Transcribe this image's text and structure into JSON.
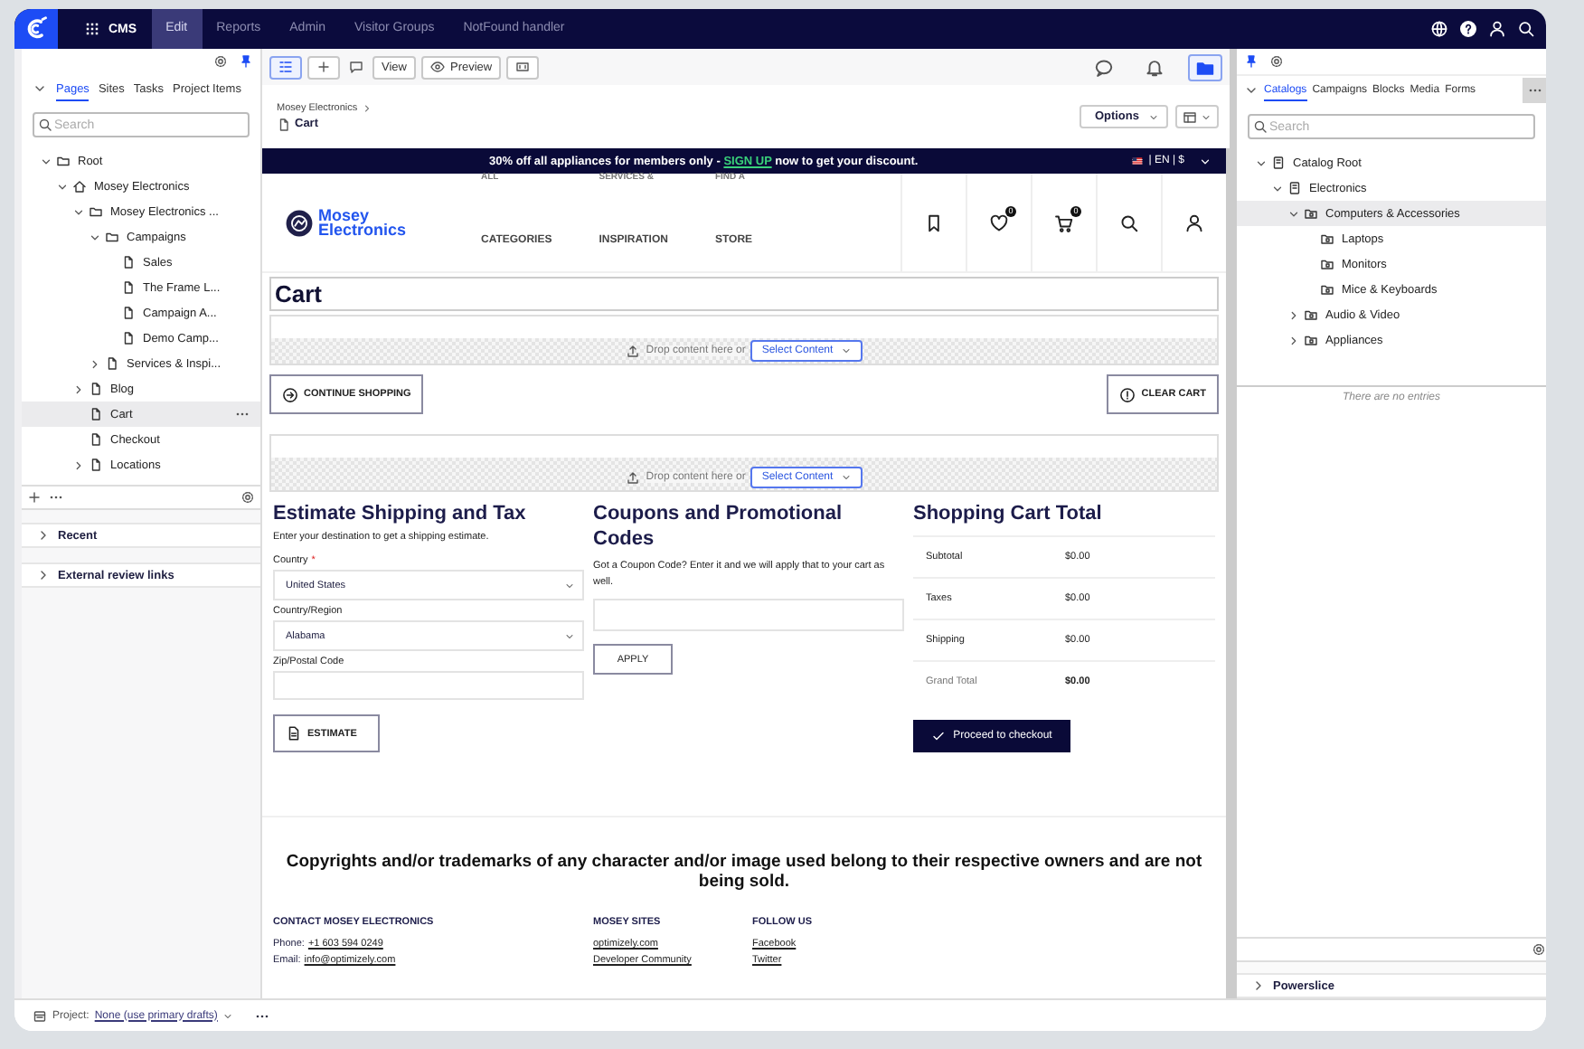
{
  "topbar": {
    "product": "CMS",
    "tabs": [
      {
        "label": "Edit",
        "selected": true
      },
      {
        "label": "Reports",
        "selected": false
      },
      {
        "label": "Admin",
        "selected": false
      },
      {
        "label": "Visitor Groups",
        "selected": false
      },
      {
        "label": "NotFound handler",
        "selected": false
      }
    ]
  },
  "left_panel": {
    "tabs": [
      {
        "label": "Pages",
        "selected": true
      },
      {
        "label": "Sites",
        "selected": false
      },
      {
        "label": "Tasks",
        "selected": false
      },
      {
        "label": "Project Items",
        "selected": false
      }
    ],
    "search": {
      "placeholder": "Search"
    },
    "tree": [
      {
        "label": "Root",
        "kind": "folder",
        "expanded": true,
        "selected": false,
        "children": [
          {
            "label": "Mosey Electronics",
            "kind": "home",
            "expanded": true,
            "selected": false,
            "children": [
              {
                "label": "Mosey Electronics ...",
                "kind": "folder",
                "expanded": true,
                "selected": false,
                "children": [
                  {
                    "label": "Campaigns",
                    "kind": "folder",
                    "expanded": true,
                    "selected": false,
                    "children": [
                      {
                        "label": "Sales",
                        "kind": "page",
                        "selected": false
                      },
                      {
                        "label": "The Frame L...",
                        "kind": "page",
                        "selected": false
                      },
                      {
                        "label": "Campaign A...",
                        "kind": "page",
                        "selected": false
                      },
                      {
                        "label": "Demo Camp...",
                        "kind": "page",
                        "selected": false
                      }
                    ]
                  },
                  {
                    "label": "Services & Inspi...",
                    "kind": "page",
                    "expanded": false,
                    "selected": false
                  }
                ]
              },
              {
                "label": "Blog",
                "kind": "page",
                "expanded": false,
                "selected": false
              },
              {
                "label": "Cart",
                "kind": "page",
                "selected": true
              },
              {
                "label": "Checkout",
                "kind": "page",
                "selected": false
              },
              {
                "label": "Locations",
                "kind": "page",
                "expanded": false,
                "selected": false
              }
            ]
          }
        ]
      }
    ],
    "sections": [
      {
        "label": "Recent",
        "expanded": false
      },
      {
        "label": "External review links",
        "expanded": false
      }
    ]
  },
  "toolbar": {
    "buttons": [
      {
        "kind": "tree",
        "selected": true
      },
      {
        "kind": "add",
        "selected": false
      },
      {
        "kind": "comment",
        "selected": false
      },
      {
        "kind": "view",
        "label": "View",
        "selected": false
      },
      {
        "kind": "preview",
        "label": "Preview",
        "selected": false
      },
      {
        "kind": "fullscreen",
        "selected": false
      }
    ],
    "right": [
      {
        "kind": "comments",
        "selected": false
      },
      {
        "kind": "notifications",
        "selected": false
      },
      {
        "kind": "assets",
        "selected": true
      }
    ]
  },
  "breadcrumb": {
    "parent": "Mosey Electronics",
    "title": "Cart"
  },
  "page_actions": {
    "options": "Options"
  },
  "site": {
    "banner": {
      "before": "30% off all appliances for members only -",
      "link": "SIGN UP",
      "after": "now to get your discount.",
      "locale": "| EN | $"
    },
    "logo": "Mosey Electronics",
    "nav": [
      {
        "top": "ALL",
        "bottom": "CATEGORIES"
      },
      {
        "top": "SERVICES &",
        "bottom": "INSPIRATION"
      },
      {
        "top": "FIND A",
        "bottom": "STORE"
      }
    ],
    "header_icons": [
      {
        "kind": "bookmark"
      },
      {
        "kind": "heart",
        "badge": "0"
      },
      {
        "kind": "cart",
        "badge": "0"
      },
      {
        "kind": "search"
      },
      {
        "kind": "user"
      }
    ],
    "heading": "Cart",
    "dropzones": [
      {
        "text": "Drop content here or",
        "button": "Select Content"
      },
      {
        "text": "Drop content here or",
        "button": "Select Content"
      }
    ],
    "actions": [
      {
        "kind": "continue",
        "label": "CONTINUE SHOPPING"
      },
      {
        "kind": "clear",
        "label": "CLEAR CART"
      }
    ],
    "shipping": {
      "title": "Estimate Shipping and Tax",
      "text": "Enter your destination to get a shipping estimate.",
      "fields": [
        {
          "kind": "select",
          "label": "Country",
          "required_mark": "*",
          "value": "United States"
        },
        {
          "kind": "select",
          "label": "Country/Region",
          "value": "Alabama"
        },
        {
          "kind": "input",
          "label": "Zip/Postal Code"
        }
      ],
      "button": "ESTIMATE"
    },
    "coupons": {
      "title": "Coupons and Promotional Codes",
      "text": "Got a Coupon Code? Enter it and we will apply that to your cart as well.",
      "button": "APPLY"
    },
    "totals": {
      "title": "Shopping Cart Total",
      "rows": [
        {
          "label": "Subtotal",
          "value": "$0.00",
          "emphasis": false
        },
        {
          "label": "Taxes",
          "value": "$0.00",
          "emphasis": false
        },
        {
          "label": "Shipping",
          "value": "$0.00",
          "emphasis": false
        },
        {
          "label": "Grand Total",
          "value": "$0.00",
          "emphasis": true
        }
      ],
      "button": "Proceed to checkout"
    },
    "footer": {
      "notice": "Copyrights and/or trademarks of any character and/or image used belong to their respective owners and are not being sold.",
      "columns": [
        {
          "title": "CONTACT MOSEY ELECTRONICS",
          "lines": [
            {
              "label": "Phone:",
              "link": "+1 603 594 0249"
            },
            {
              "label": "Email:",
              "link": "info@optimizely.com"
            }
          ]
        },
        {
          "title": "MOSEY SITES",
          "lines": [
            {
              "link": "optimizely.com"
            },
            {
              "link": "Developer Community"
            }
          ]
        },
        {
          "title": "FOLLOW US",
          "lines": [
            {
              "link": "Facebook"
            },
            {
              "link": "Twitter"
            }
          ]
        }
      ]
    }
  },
  "right_panel": {
    "tabs": [
      {
        "label": "Catalogs",
        "selected": true
      },
      {
        "label": "Campaigns",
        "selected": false
      },
      {
        "label": "Blocks",
        "selected": false
      },
      {
        "label": "Media",
        "selected": false
      },
      {
        "label": "Forms",
        "selected": false
      }
    ],
    "search": {
      "placeholder": "Search"
    },
    "tree": [
      {
        "label": "Catalog Root",
        "kind": "catalog",
        "expanded": true,
        "selected": false,
        "children": [
          {
            "label": "Electronics",
            "kind": "catalog",
            "expanded": true,
            "selected": false,
            "children": [
              {
                "label": "Computers & Accessories",
                "kind": "category",
                "expanded": true,
                "selected": true,
                "children": [
                  {
                    "label": "Laptops",
                    "kind": "category",
                    "selected": false
                  },
                  {
                    "label": "Monitors",
                    "kind": "category",
                    "selected": false
                  },
                  {
                    "label": "Mice & Keyboards",
                    "kind": "category",
                    "selected": false
                  }
                ]
              },
              {
                "label": "Audio & Video",
                "kind": "category",
                "expanded": false,
                "selected": false
              },
              {
                "label": "Appliances",
                "kind": "category",
                "expanded": false,
                "selected": false
              }
            ]
          }
        ]
      }
    ],
    "empty_text": "There are no entries",
    "sections": [
      {
        "label": "Powerslice",
        "expanded": false
      }
    ]
  },
  "status_bar": {
    "project_label": "Project:",
    "project_value": "None (use primary drafts)"
  }
}
